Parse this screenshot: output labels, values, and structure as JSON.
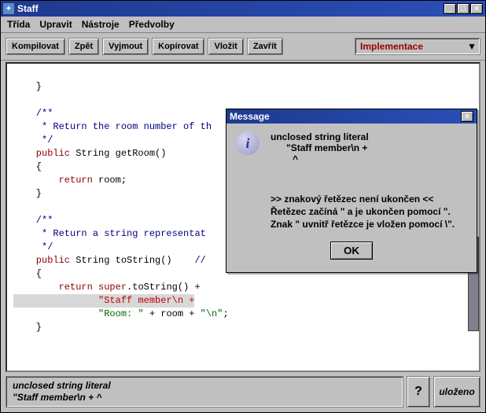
{
  "title": "Staff",
  "menu": {
    "trida": "Třída",
    "upravit": "Upravit",
    "nastroje": "Nástroje",
    "predvolby": "Předvolby"
  },
  "toolbar": {
    "compile": "Kompilovat",
    "undo": "Zpět",
    "cut": "Vyjmout",
    "copy": "Kopírovat",
    "paste": "Vložit",
    "close": "Zavřít",
    "combo_value": "Implementace"
  },
  "code": {
    "l1": "    }",
    "l2": "",
    "l3": "    /**",
    "l4": "     * Return the room number of th",
    "l5": "     */",
    "l6_kw1": "    public",
    "l6_rest": " String getRoom()",
    "l7": "    {",
    "l8_kw": "        return",
    "l8_rest": " room;",
    "l9": "    }",
    "l10": "",
    "l11": "    /**",
    "l12": "     * Return a string representat",
    "l13": "     */",
    "l14_kw1": "    public",
    "l14_rest": " String toString()    ",
    "l14_c": "//",
    "l15": "    {",
    "l16_kw": "        return ",
    "l16_a": "super",
    "l16_b": ".toString() +",
    "l17_pad": "               ",
    "l17_err": "\"Staff member\\n +",
    "l18_pad": "               ",
    "l18_str1": "\"Room: \"",
    "l18_mid": " + room + ",
    "l18_str2": "\"\\n\"",
    "l18_end": ";",
    "l19": "    }"
  },
  "dialog": {
    "title": "Message",
    "line1": "unclosed string literal",
    "line2": "\"Staff member\\n +",
    "line3": "^",
    "explain1": ">> znakový řetězec není ukončen <<",
    "explain2": "Řetězec začíná \" a je ukončen pomocí \".",
    "explain3": "Znak \" uvnitř řetězce je vložen pomocí \\\".",
    "ok": "OK"
  },
  "status": {
    "line1": "unclosed string literal",
    "line2": "        \"Staff member\\n +                     ^",
    "help": "?",
    "saved": "uloženo"
  }
}
